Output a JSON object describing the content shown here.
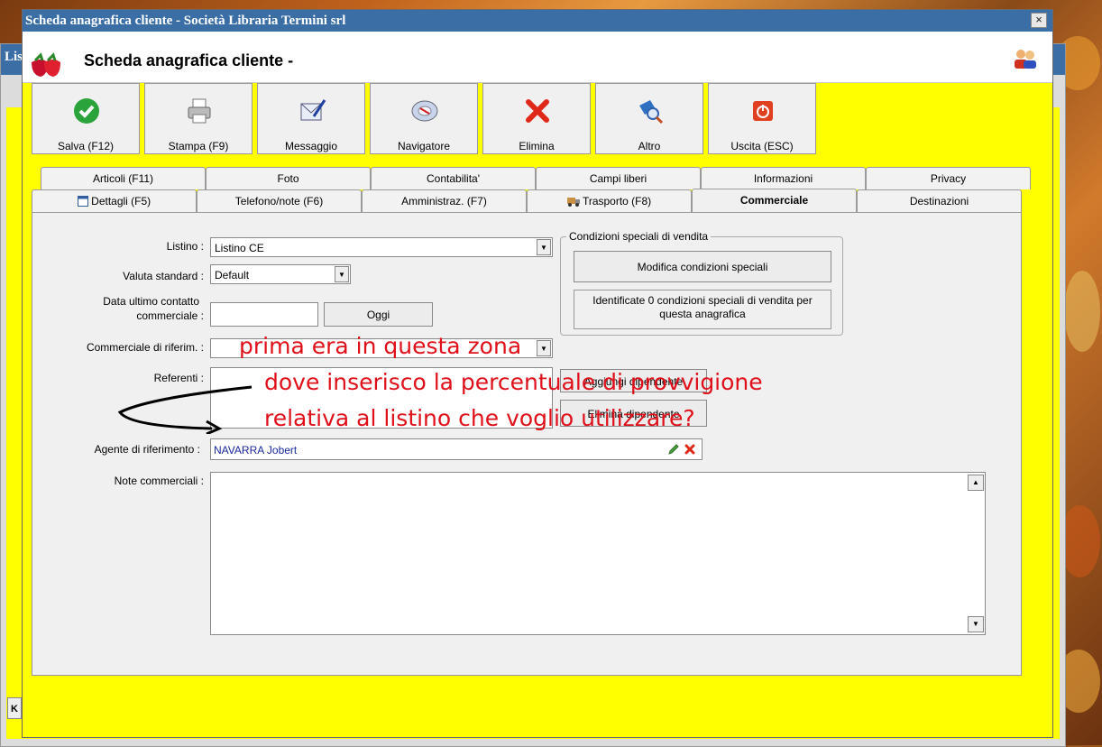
{
  "window": {
    "title": "Scheda anagrafica cliente - Società Libraria Termini srl",
    "close_symbol": "×"
  },
  "background_window": {
    "title_fragment": "Lis",
    "side_key": "K"
  },
  "header": {
    "title": "Scheda anagrafica cliente -"
  },
  "toolbar": [
    {
      "label": "Salva (F12)",
      "icon": "check-icon"
    },
    {
      "label": "Stampa (F9)",
      "icon": "printer-icon"
    },
    {
      "label": "Messaggio",
      "icon": "message-icon"
    },
    {
      "label": "Navigatore",
      "icon": "compass-icon"
    },
    {
      "label": "Elimina",
      "icon": "delete-icon"
    },
    {
      "label": "Altro",
      "icon": "search-icon"
    },
    {
      "label": "Uscita (ESC)",
      "icon": "power-icon"
    }
  ],
  "tabs_top": [
    "Articoli (F11)",
    "Foto",
    "Contabilita'",
    "Campi liberi",
    "Informazioni",
    "Privacy"
  ],
  "tabs_bottom": [
    "Dettagli (F5)",
    "Telefono/note (F6)",
    "Amministraz. (F7)",
    "Trasporto (F8)",
    "Commerciale",
    "Destinazioni"
  ],
  "active_tab": "Commerciale",
  "form": {
    "listino_label": "Listino :",
    "listino_value": "Listino CE",
    "valuta_label": "Valuta standard :",
    "valuta_value": "Default",
    "data_label_1": "Data ultimo contatto",
    "data_label_2": "commerciale :",
    "data_value": "",
    "oggi_button": "Oggi",
    "commerciale_label": "Commerciale di riferim. :",
    "commerciale_value": "",
    "referenti_label": "Referenti :",
    "aggiungi_button": "Aggiungi dipendente",
    "elimina_dip_button": "Elimina dipendente",
    "agente_label": "Agente di riferimento :",
    "agente_value": "NAVARRA Jobert",
    "note_label": "Note commerciali :"
  },
  "special_conditions": {
    "group_title": "Condizioni speciali di vendita",
    "modify_button": "Modifica condizioni speciali",
    "info_line_1": "Identificate 0 condizioni speciali di vendita per",
    "info_line_2": "questa anagrafica"
  },
  "annotation": {
    "line1": "prima era in questa zona",
    "line2": "dove inserisco la percentuale di provvigione",
    "line3": "relativa al listino che voglio utilizzare?",
    "color": "#e0101a"
  },
  "colors": {
    "window_bg": "#ffff00",
    "titlebar": "#3a6ea5",
    "agent_text": "#1a2a9a"
  }
}
